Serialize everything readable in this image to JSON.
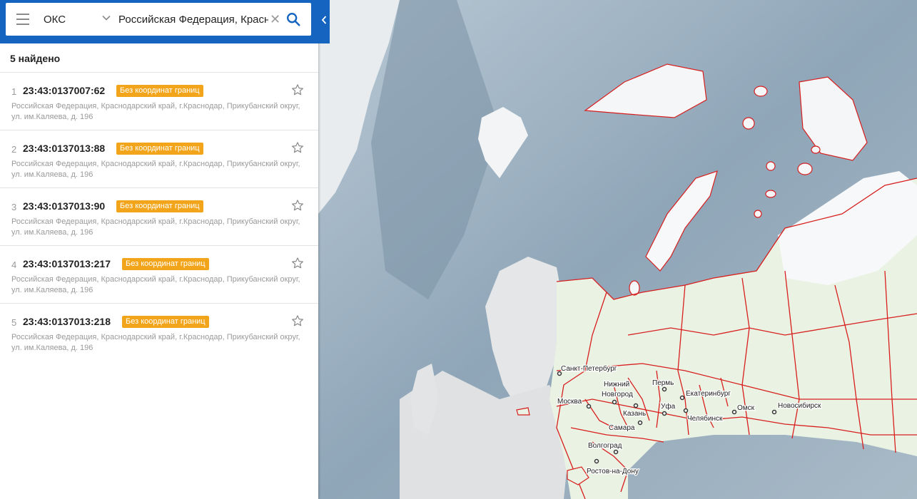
{
  "search": {
    "type_value": "ОКС",
    "query": "Российская Федерация, Красн",
    "icons": {
      "menu": "hamburger-icon",
      "dropdown": "chevron-down-icon",
      "clear": "close-icon",
      "search": "search-icon",
      "collapse": "chevron-left-icon"
    }
  },
  "results": {
    "count_label": "5 найдено",
    "items": [
      {
        "num": "1",
        "cad": "23:43:0137007:62",
        "badge": "Без координат границ",
        "addr": "Российская Федерация, Краснодарский край, г.Краснодар, Прикубанский округ, ул. им.Каляева, д. 196"
      },
      {
        "num": "2",
        "cad": "23:43:0137013:88",
        "badge": "Без координат границ",
        "addr": "Российская Федерация, Краснодарский край, г.Краснодар, Прикубанский округ, ул. им.Каляева, д. 196"
      },
      {
        "num": "3",
        "cad": "23:43:0137013:90",
        "badge": "Без координат границ",
        "addr": "Российская Федерация, Краснодарский край, г.Краснодар, Прикубанский округ, ул. им.Каляева, д. 196"
      },
      {
        "num": "4",
        "cad": "23:43:0137013:217",
        "badge": "Без координат границ",
        "addr": "Российская Федерация, Краснодарский край, г.Краснодар, Прикубанский округ, ул. им.Каляева, д. 196"
      },
      {
        "num": "5",
        "cad": "23:43:0137013:218",
        "badge": "Без координат границ",
        "addr": "Российская Федерация, Краснодарский край, г.Краснодар, Прикубанский округ, ул. им.Каляева, д. 196"
      }
    ]
  },
  "map": {
    "cities": [
      "Санкт-Петербург",
      "Нижний",
      "Новгород",
      "Пермь",
      "Екатеринбург",
      "Москва",
      "Уфа",
      "Омск",
      "Новосибирск",
      "Казань",
      "Челябинск",
      "Самара",
      "Волгоград",
      "Ростов-на-Дону"
    ]
  },
  "colors": {
    "topbar": "#1565c0",
    "badge": "#f2a51a",
    "region_border": "#d81e1e",
    "sea": "#9fb2c2",
    "land_russia": "#eaf3e3"
  }
}
